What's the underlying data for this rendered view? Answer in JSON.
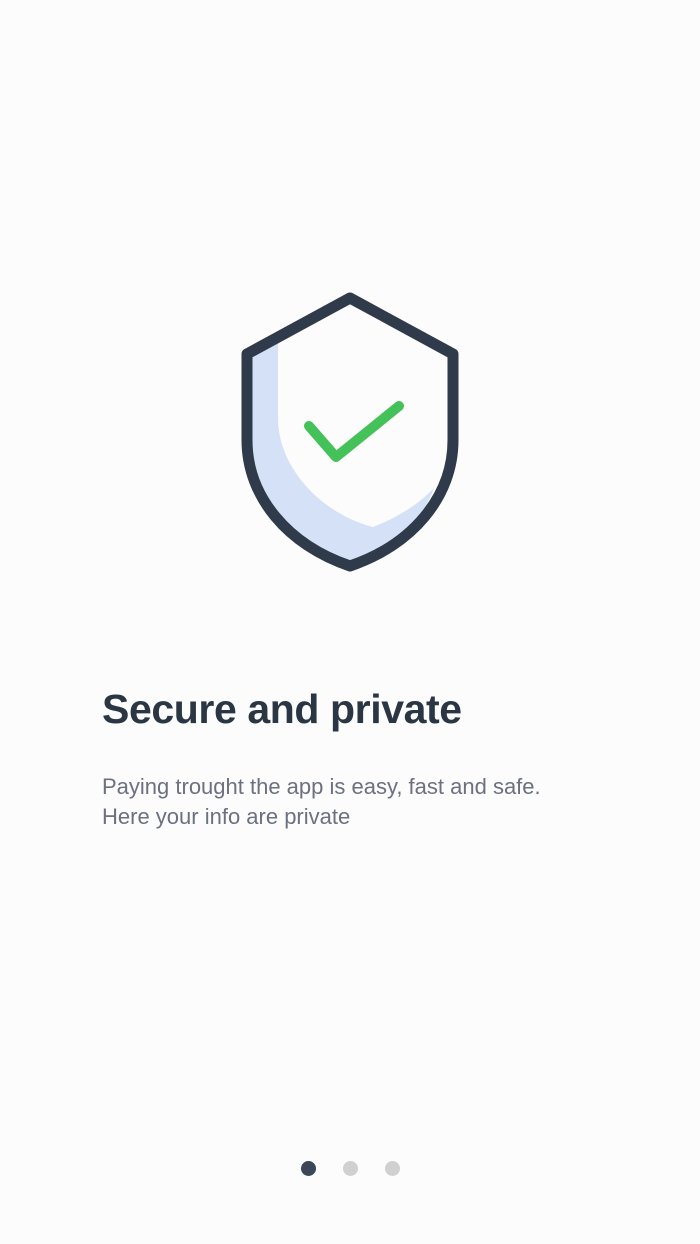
{
  "onboarding": {
    "title": "Secure and private",
    "description": [
      "Paying trought the app is easy, fast and safe.",
      "Here your info are private"
    ],
    "illustration_icon": "shield-check-icon",
    "colors": {
      "background": "#fcfcfc",
      "title": "#2b3645",
      "body_text": "#6c7080",
      "shield_outline": "#2f3a4a",
      "shield_fill": "#d5e1f7",
      "check": "#45c15a",
      "dot_active": "#3b4657",
      "dot_inactive": "#d0d0d0"
    }
  },
  "pager": {
    "current_page": 1,
    "total_pages": 3
  }
}
